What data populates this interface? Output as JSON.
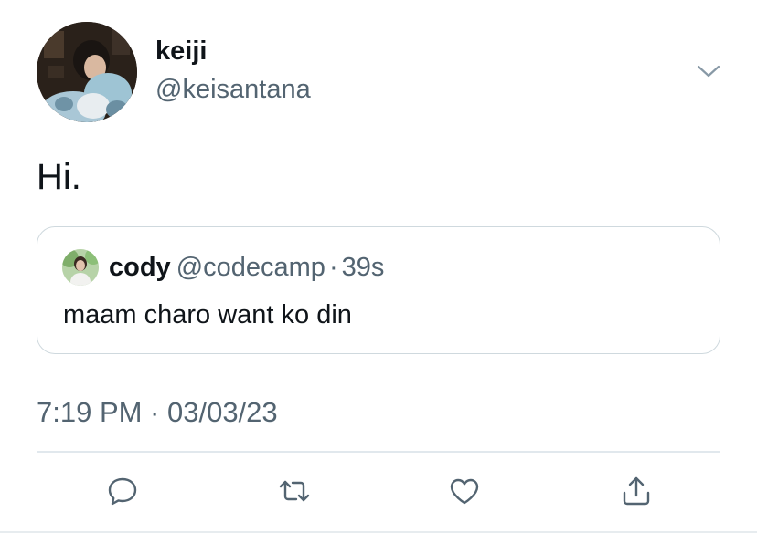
{
  "author": {
    "name": "keiji",
    "handle": "@keisantana",
    "avatar_icon": "profile-photo"
  },
  "tweet": {
    "text": "Hi.",
    "timestamp": "7:19 PM · 03/03/23"
  },
  "quoted_tweet": {
    "name": "cody",
    "handle": "@codecamp",
    "separator": "·",
    "time": "39s",
    "text": "maam charo want ko din",
    "avatar_icon": "profile-photo"
  },
  "actions": {
    "reply_icon": "reply-icon",
    "retweet_icon": "retweet-icon",
    "like_icon": "heart-icon",
    "share_icon": "share-icon"
  },
  "colors": {
    "text_primary": "#0f1419",
    "text_secondary": "#536471",
    "border": "#cfd9de",
    "icon": "#536471"
  }
}
